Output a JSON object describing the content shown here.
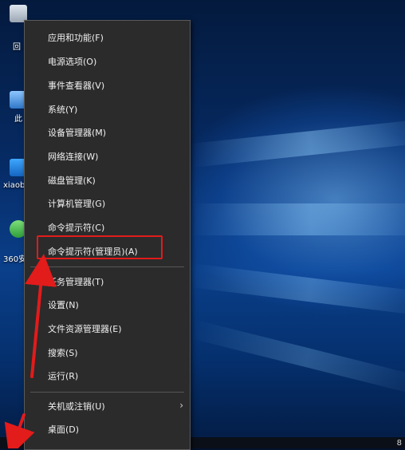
{
  "desktop": {
    "icons": [
      {
        "label": "回",
        "name": "recycle-bin"
      },
      {
        "label": "此",
        "name": "this-pc"
      },
      {
        "label": "xiaob",
        "name": "xiaobai"
      },
      {
        "label": "360安",
        "name": "360-security"
      }
    ]
  },
  "context_menu": {
    "items": [
      "应用和功能(F)",
      "电源选项(O)",
      "事件查看器(V)",
      "系统(Y)",
      "设备管理器(M)",
      "网络连接(W)",
      "磁盘管理(K)",
      "计算机管理(G)",
      "命令提示符(C)",
      "命令提示符(管理员)(A)",
      "任务管理器(T)",
      "设置(N)",
      "文件资源管理器(E)",
      "搜索(S)",
      "运行(R)",
      "关机或注销(U)",
      "桌面(D)"
    ],
    "submenu_arrow": "›"
  },
  "taskbar": {
    "start_icon": "windows-logo-icon",
    "tray_text": "8"
  },
  "colors": {
    "menu_bg": "#2b2b2b",
    "annotation": "#e21b1b"
  }
}
